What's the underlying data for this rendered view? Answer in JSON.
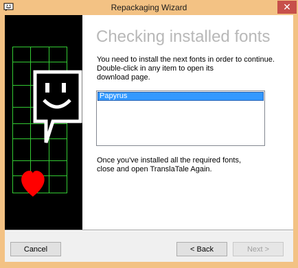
{
  "window": {
    "title": "Repackaging Wizard",
    "close_glyph": "✕",
    "app_icon": "smiley-speech-icon"
  },
  "banner": {
    "icons": [
      "grid-lines",
      "smiley-speech-bubble-icon",
      "heart-icon"
    ],
    "colors": {
      "background": "#000000",
      "grid": "#33cc33",
      "heart": "#ff0000",
      "bubble": "#ffffff"
    }
  },
  "content": {
    "heading": "Checking installed fonts",
    "instructions": "You need to install the next fonts in order to continue.\nDouble-click in any item to open its\ndownload page.",
    "fonts_list": [
      "Papyrus"
    ],
    "selected_font": "Papyrus",
    "footer_text": "Once you've installed all the required fonts,\nclose and open TranslaTale Again."
  },
  "buttons": {
    "cancel": "Cancel",
    "back": "< Back",
    "next": "Next >",
    "next_enabled": false
  },
  "colors": {
    "selection": "#3399ff",
    "heading": "#b8b8b8",
    "close_button": "#c7504a",
    "frame": "#f3c284"
  }
}
